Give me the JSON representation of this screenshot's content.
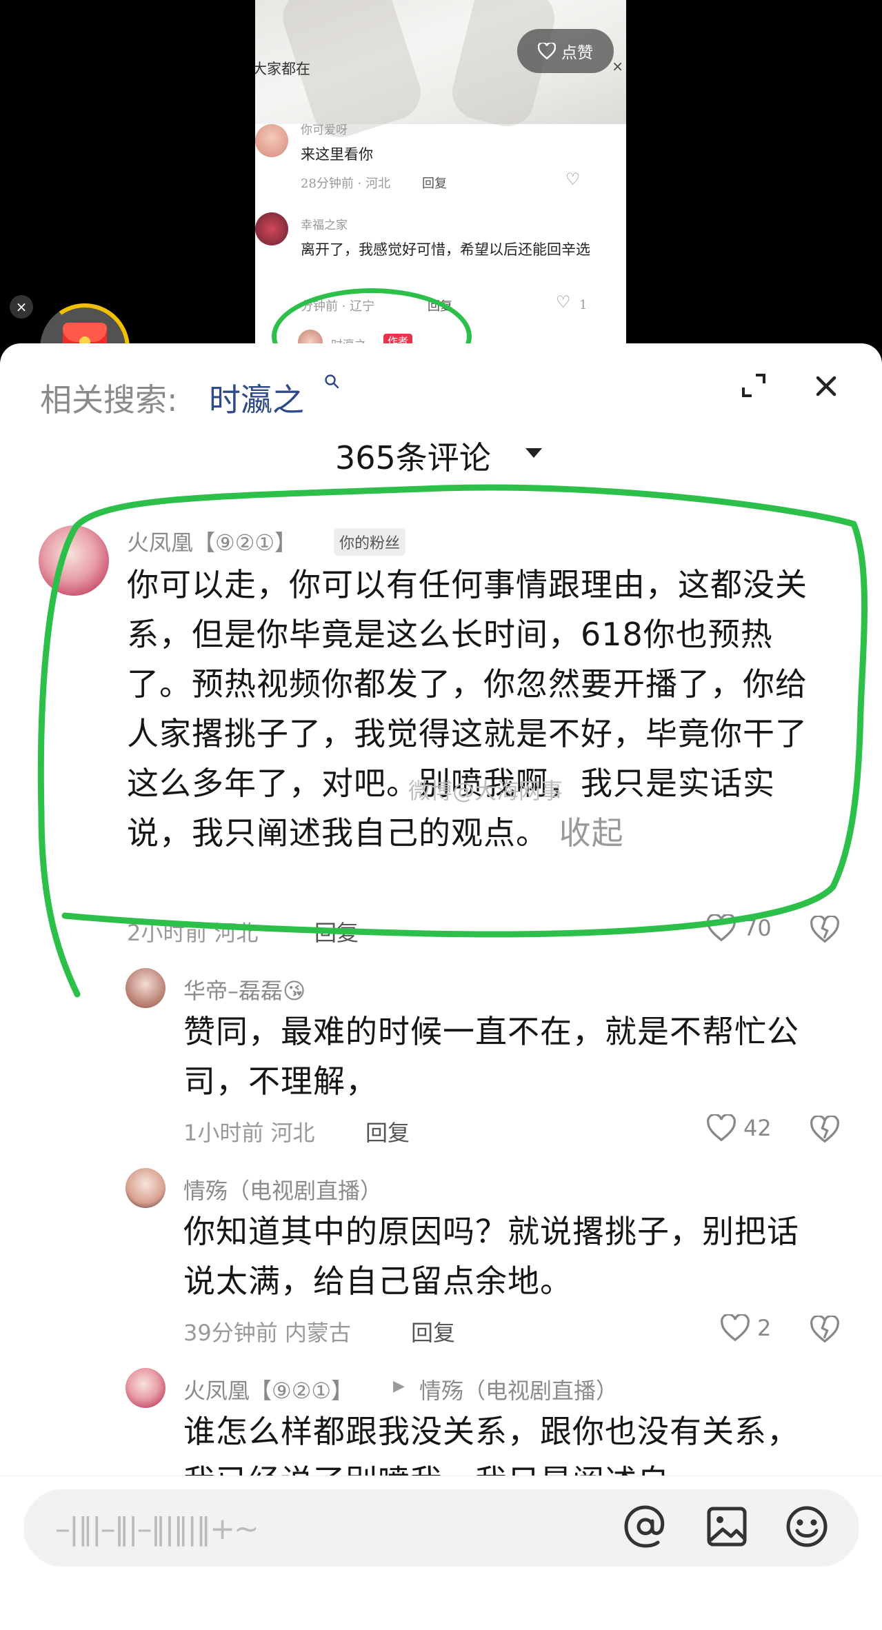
{
  "video": {
    "like_button_label": "点赞",
    "ticker_text": "大家都在",
    "close_glyph": "×",
    "comments": [
      {
        "name": "你可爱呀",
        "text": "来这里看你",
        "meta": "28分钟前 · 河北",
        "reply": "回复"
      },
      {
        "name": "幸福之家",
        "text": "离开了，我感觉好可惜，希望以后还能回辛选",
        "meta": "分钟前 · 辽宁",
        "reply": "回复",
        "likes": "1"
      },
      {
        "name": "时瀛之",
        "badge": "作者"
      }
    ]
  },
  "floating": {
    "close_glyph": "×"
  },
  "sheet": {
    "search_label": "相关搜索:",
    "search_term": "时瀛之",
    "comment_count": "365条评论"
  },
  "comments": [
    {
      "user": "火凤凰【⑨②①】",
      "badge": "你的粉丝",
      "text": "你可以走，你可以有任何事情跟理由，这都没关系，但是你毕竟是这么长时间，618你也预热了。预热视频你都发了，你忽然要开播了，你给人家撂挑子了，我觉得这就是不好，毕竟你干了这么多年了，对吧。别喷我啊，我只是实话实说，我只阐述我自己的观点。",
      "collapse": "收起",
      "meta": "2小时前 河北",
      "reply": "回复",
      "likes": "70"
    },
    {
      "user": "华帝–磊磊😘",
      "text": "赞同，最难的时候一直不在，就是不帮忙公司，不理解，",
      "meta": "1小时前 河北",
      "reply": "回复",
      "likes": "42"
    },
    {
      "user": "情殇（电视剧直播）",
      "text": "你知道其中的原因吗？就说撂挑子，别把话说太满，给自己留点余地。",
      "meta": "39分钟前 内蒙古",
      "reply": "回复",
      "likes": "2"
    },
    {
      "user": "火凤凰【⑨②①】",
      "reply_to": "情殇（电视剧直播）",
      "text": "谁怎么样都跟我没关系，跟你也没有关系，我已经说了别喷我，我只是阐述自"
    }
  ],
  "watermark": "微博@大海网事",
  "input": {
    "placeholder": "–|‖|–‖|–‖|‖|‖+~"
  },
  "colors": {
    "accent_green": "#2cc04a",
    "envelope_red": "#ee2c2c",
    "link_blue": "#2f4a8a"
  },
  "icons": [
    "heart-icon",
    "dislike-icon",
    "expand-icon",
    "close-icon",
    "search-icon",
    "at-icon",
    "image-icon",
    "emoji-icon",
    "red-envelope-icon"
  ]
}
